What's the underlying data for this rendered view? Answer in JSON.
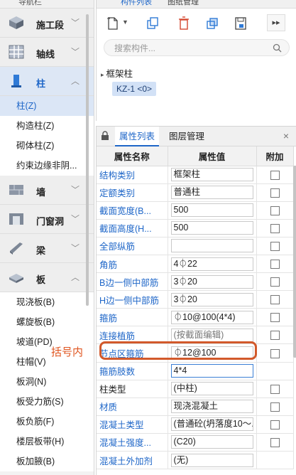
{
  "nav": {
    "title": "导航栏",
    "categories": [
      {
        "label": "施工段",
        "icon": "cube-icon"
      },
      {
        "label": "轴线",
        "icon": "grid-icon"
      },
      {
        "label": "柱",
        "icon": "column-icon"
      },
      {
        "label": "墙",
        "icon": "wall-icon"
      },
      {
        "label": "门窗洞",
        "icon": "door-window-icon"
      },
      {
        "label": "梁",
        "icon": "beam-icon"
      },
      {
        "label": "板",
        "icon": "slab-icon"
      }
    ],
    "column_items": [
      "柱(Z)",
      "构造柱(Z)",
      "砌体柱(Z)",
      "约束边缘非阴..."
    ],
    "slab_items": [
      "现浇板(B)",
      "螺旋板(B)",
      "坡道(PD)",
      "柱帽(V)",
      "板洞(N)",
      "板受力筋(S)",
      "板负筋(F)",
      "楼层板带(H)",
      "板加腋(B)"
    ]
  },
  "component_panel": {
    "tab_label": "构件列表",
    "tab2_label": "图纸管理",
    "search_placeholder": "搜索构件...",
    "tree_root": "框架柱",
    "tree_item": "KZ-1 <0>"
  },
  "property_panel": {
    "tab_active": "属性列表",
    "tab_inactive": "图层管理",
    "close": "×",
    "headers": {
      "name": "属性名称",
      "value": "属性值",
      "extra": "附加"
    },
    "rows": [
      {
        "name": "结构类别",
        "value": "框架柱",
        "has_check": true,
        "name_color": "blue"
      },
      {
        "name": "定额类别",
        "value": "普通柱",
        "has_check": true,
        "name_color": "blue"
      },
      {
        "name": "截面宽度(B...",
        "value": "500",
        "has_check": true,
        "name_color": "blue"
      },
      {
        "name": "截面高度(H...",
        "value": "500",
        "has_check": true,
        "name_color": "blue"
      },
      {
        "name": "全部纵筋",
        "value": "",
        "has_check": true,
        "name_color": "blue"
      },
      {
        "name": "角筋",
        "value": "4⏀22",
        "has_check": true,
        "name_color": "blue"
      },
      {
        "name": "B边一侧中部筋",
        "value": "3⏀20",
        "has_check": true,
        "name_color": "blue"
      },
      {
        "name": "H边一侧中部筋",
        "value": "3⏀20",
        "has_check": true,
        "name_color": "blue"
      },
      {
        "name": "箍筋",
        "value": "⏀10@100(4*4)",
        "has_check": true,
        "name_color": "blue"
      },
      {
        "name": "连接植筋",
        "value": "(按截面编辑)",
        "has_check": true,
        "name_color": "blue",
        "value_gray": true
      },
      {
        "name": "节点区箍筋",
        "value": "⏀12@100",
        "has_check": true,
        "name_color": "blue"
      },
      {
        "name": "箍筋肢数",
        "value": "4*4",
        "has_check": false,
        "name_color": "blue",
        "editing": true
      },
      {
        "name": "柱类型",
        "value": "(中柱)",
        "has_check": true,
        "name_color": "black"
      },
      {
        "name": "材质",
        "value": "现浇混凝土",
        "has_check": true,
        "name_color": "blue"
      },
      {
        "name": "混凝土类型",
        "value": "(普通砼(坍落度10～...",
        "has_check": true,
        "name_color": "blue"
      },
      {
        "name": "混凝土强度...",
        "value": "(C20)",
        "has_check": true,
        "name_color": "blue"
      },
      {
        "name": "混凝土外加剂",
        "value": "(无)",
        "has_check": false,
        "name_color": "blue"
      }
    ]
  },
  "annotation": {
    "text": "括号内",
    "color": "#e0551f"
  },
  "colors": {
    "accent": "#1e66c8",
    "highlight": "#d2592b"
  }
}
